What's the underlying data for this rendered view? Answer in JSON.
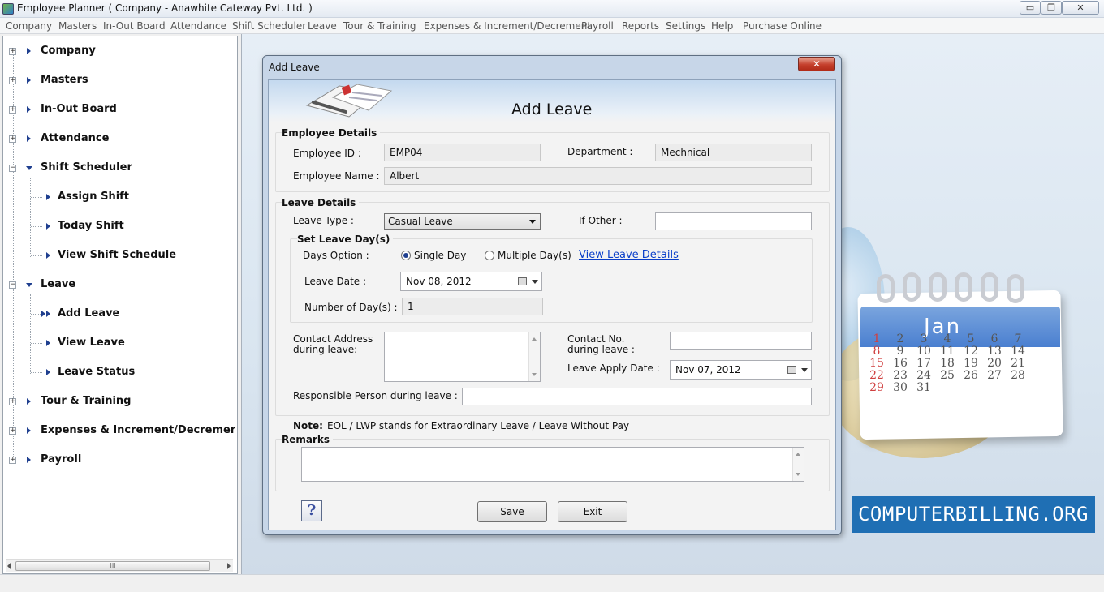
{
  "window": {
    "title": "Employee Planner ( Company - Anawhite Cateway Pvt. Ltd. )",
    "minimize": "▭",
    "restore": "❐",
    "close": "✕"
  },
  "menu": [
    "Company",
    "Masters",
    "In-Out Board",
    "Attendance",
    "Shift Scheduler",
    "Leave",
    "Tour & Training",
    "Expenses & Increment/Decrement",
    "Payroll",
    "Reports",
    "Settings",
    "Help",
    "Purchase Online"
  ],
  "tree": {
    "company": "Company",
    "masters": "Masters",
    "in_out_board": "In-Out Board",
    "attendance": "Attendance",
    "shift_scheduler": "Shift Scheduler",
    "assign_shift": "Assign Shift",
    "today_shift": "Today Shift",
    "view_shift_schedule": "View Shift Schedule",
    "leave": "Leave",
    "add_leave": "Add Leave",
    "view_leave": "View Leave",
    "leave_status": "Leave Status",
    "tour_training": "Tour & Training",
    "expenses": "Expenses & Increment/Decremen",
    "payroll": "Payroll",
    "scroll_thumb": "III"
  },
  "dialog": {
    "title": "Add Leave",
    "heading": "Add Leave",
    "close": "✕",
    "employee_details": {
      "title": "Employee Details",
      "employee_id_label": "Employee ID :",
      "employee_id": "EMP04",
      "department_label": "Department :",
      "department": "Mechnical",
      "employee_name_label": "Employee Name :",
      "employee_name": "Albert"
    },
    "leave_details": {
      "title": "Leave Details",
      "leave_type_label": "Leave Type :",
      "leave_type": "Casual Leave",
      "if_other_label": "If Other :",
      "if_other": "",
      "set_leave_days": "Set Leave Day(s)",
      "days_option_label": "Days Option :",
      "single_day": "Single Day",
      "multiple_days": "Multiple Day(s)",
      "selected_option": "single",
      "view_leave_details": "View Leave Details",
      "leave_date_label": "Leave Date :",
      "leave_date": "Nov 08, 2012",
      "num_days_label": "Number of Day(s) :",
      "num_days": "1",
      "contact_address_label_1": "Contact Address",
      "contact_address_label_2": "during leave:",
      "contact_no_label_1": "Contact No.",
      "contact_no_label_2": "during leave :",
      "leave_apply_date_label": "Leave Apply Date :",
      "leave_apply_date": "Nov 07, 2012",
      "responsible_label": "Responsible Person during leave :"
    },
    "note_label": "Note:",
    "note_text": "EOL / LWP stands for Extraordinary Leave / Leave Without Pay",
    "remarks_label": "Remarks",
    "help": "?",
    "save": "Save",
    "exit": "Exit"
  },
  "calendar_decoration": {
    "month": "Jan",
    "rows": [
      [
        "1",
        "2",
        "3",
        "4",
        "5",
        "6",
        "7"
      ],
      [
        "8",
        "9",
        "10",
        "11",
        "12",
        "13",
        "14"
      ],
      [
        "15",
        "16",
        "17",
        "18",
        "19",
        "20",
        "21"
      ],
      [
        "22",
        "23",
        "24",
        "25",
        "26",
        "27",
        "28"
      ],
      [
        "29",
        "30",
        "31"
      ]
    ]
  },
  "brand": "COMPUTERBILLING.ORG"
}
